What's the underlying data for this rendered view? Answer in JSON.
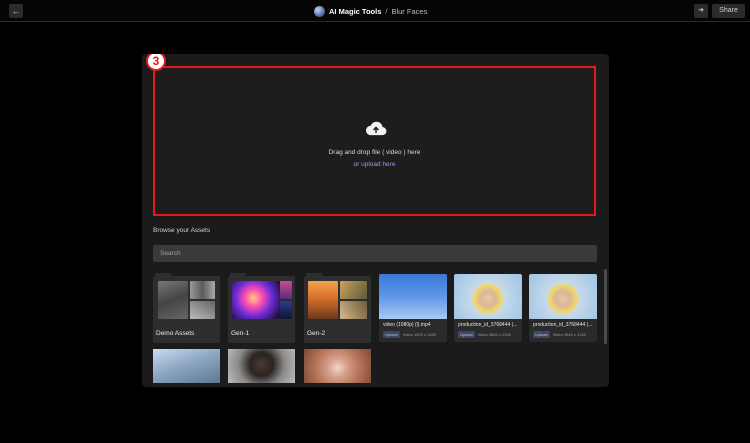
{
  "topbar": {
    "back_icon": "arrow-left-icon",
    "app_name": "AI Magic Tools",
    "separator": "/",
    "page_name": "Blur Faces",
    "share_label": "Share",
    "side_icon": "arrow-right-icon"
  },
  "dropzone": {
    "step_number": "3",
    "icon": "cloud-upload-icon",
    "instruction": "Drag and drop file ( video ) here",
    "upload_link": "or upload here"
  },
  "assets": {
    "title": "Browse your Assets",
    "search_placeholder": "Search",
    "folders": [
      {
        "name": "Demo Assets"
      },
      {
        "name": "Gen-1"
      },
      {
        "name": "Gen-2"
      }
    ],
    "files": [
      {
        "filename": "video (1080p) (l).mp4",
        "badge": "Upload",
        "resolution": "Video 1920 x 1080"
      },
      {
        "filename": "production_id_3768444 (...",
        "badge": "Upload",
        "resolution": "Video 3840 x 2160"
      },
      {
        "filename": "production_id_3768444 (...",
        "badge": "Upload",
        "resolution": "Video 3840 x 2160"
      }
    ]
  },
  "colors": {
    "highlight": "#e11b1b",
    "link": "#b48cf2",
    "panel": "#1b1b1b"
  }
}
